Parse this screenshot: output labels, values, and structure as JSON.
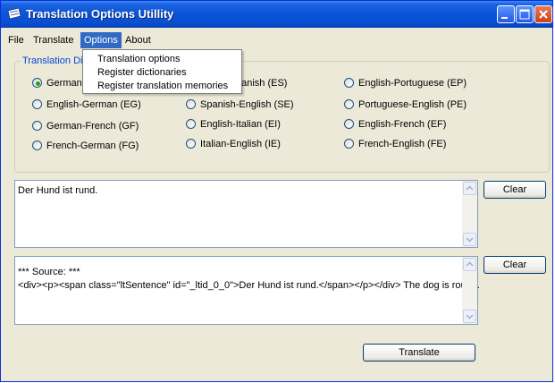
{
  "window": {
    "title": "Translation Options Utillity"
  },
  "menu": {
    "file": "File",
    "translate": "Translate",
    "options": "Options",
    "about": "About"
  },
  "options_menu": [
    "Translation options",
    "Register dictionaries",
    "Register translation memories"
  ],
  "group": {
    "label": "Translation Dir"
  },
  "radios": {
    "col1": [
      "German-",
      "English-German (EG)",
      "German-French (GF)",
      "French-German (FG)"
    ],
    "col2": [
      "panish (ES)",
      "Spanish-English (SE)",
      "English-Italian (EI)",
      "Italian-English (IE)"
    ],
    "col3": [
      "English-Portuguese (EP)",
      "Portuguese-English (PE)",
      "English-French (EF)",
      "French-English (FE)"
    ],
    "selected": "German-"
  },
  "input": {
    "text": "Der Hund ist rund."
  },
  "output": {
    "line1": "*** Source: ***",
    "line2": "<div><p><span class=\"ltSentence\" id=\"_ltid_0_0\">Der Hund ist rund.</span></p></div> The dog is round."
  },
  "buttons": {
    "clear1": "Clear",
    "clear2": "Clear",
    "translate": "Translate"
  },
  "colors": {
    "titlebar": "#0a55d8",
    "menu_highlight": "#316ac5",
    "group_label": "#0046d5",
    "window_bg": "#ece9d8"
  }
}
